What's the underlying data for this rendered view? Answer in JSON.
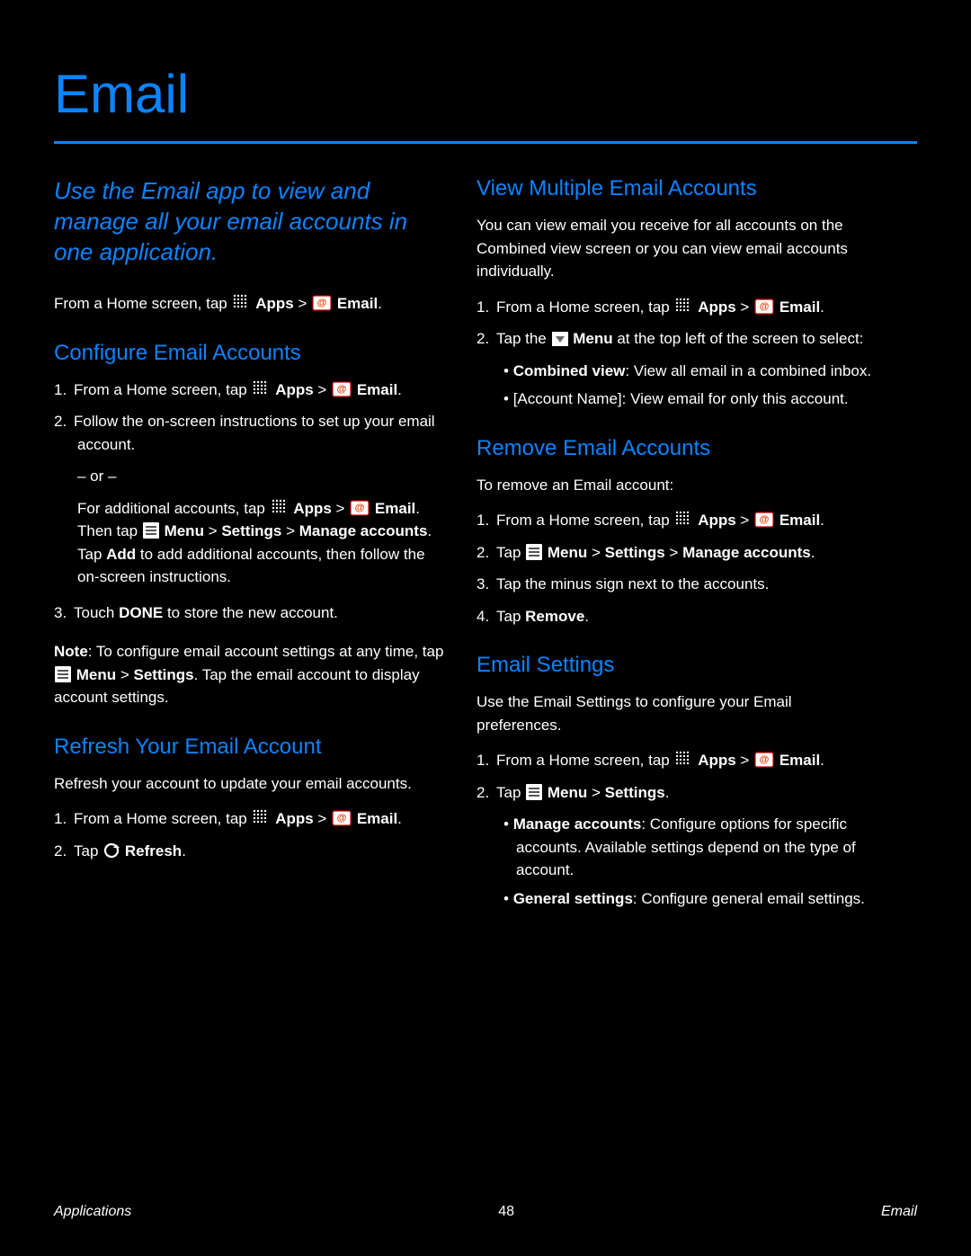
{
  "page_title": "Email",
  "intro": "Use the Email app to view and manage all your email accounts in one application.",
  "launch_prefix": "From a Home screen, tap ",
  "apps_label": "Apps",
  "email_label": "Email",
  "sections": {
    "configure": {
      "title": "Configure Email Accounts",
      "s1_a": "1.",
      "s1_b": "From a Home screen, tap ",
      "s1_c": "Apps",
      "s1_d": " > ",
      "s1_e": "Email",
      "s2_a": "2.",
      "s2_b": "Follow the on-screen instructions to set up your email account.",
      "or": "– or –",
      "alt_a": "For additional accounts, tap ",
      "alt_b": "Apps",
      "alt_c": " > ",
      "alt_d": "Email",
      "alt_e": ". Then tap ",
      "alt_f": "Menu",
      "alt_g": " > ",
      "alt_h": "Settings",
      "alt_i": " > ",
      "alt_j": "Manage accounts",
      "alt_k": ". Tap ",
      "alt_l": "Add",
      "alt_m": " to add additional accounts, then follow the on-screen instructions.",
      "s3_a": "3.",
      "s3_b": "Touch ",
      "s3_c": "DONE",
      "s3_d": " to store the new account.",
      "note_a": "Note",
      "note_b": ": To configure email account settings at any time, tap ",
      "note_c": "Menu",
      "note_d": " > ",
      "note_e": "Settings",
      "note_f": ". Tap the email account to display account settings."
    },
    "refresh": {
      "title": "Refresh Your Email Account",
      "lead": "Refresh your account to update your email accounts.",
      "s1_a": "1.",
      "s1_b": "From a Home screen, tap ",
      "s1_c": "Apps",
      "s1_d": " > ",
      "s1_e": "Email",
      "s2_a": "2.",
      "s2_b": "Tap ",
      "s2_c": "Refresh"
    },
    "view": {
      "title": "View Multiple Email Accounts",
      "lead": "You can view email you receive for all accounts on the Combined view screen or you can view email accounts individually.",
      "s1_a": "1.",
      "s1_b": "From a Home screen, tap ",
      "s1_c": "Apps",
      "s1_d": " > ",
      "s1_e": "Email",
      "s2_a": "2.",
      "s2_b": "Tap the ",
      "s2_c": "Menu",
      "s2_d": " at the top left of the screen to select:",
      "opt1_a": "Combined view",
      "opt1_b": ": View all email in a combined inbox.",
      "opt2": "[Account Name]: View email for only this account."
    },
    "remove": {
      "title": "Remove Email Accounts",
      "lead": "To remove an Email account:",
      "s1_a": "1.",
      "s1_b": "From a Home screen, tap ",
      "s1_c": "Apps",
      "s1_d": " > ",
      "s1_e": "Email",
      "s2_a": "2.",
      "s2_b": "Tap ",
      "s2_c": "Menu",
      "s2_d": " > ",
      "s2_e": "Settings",
      "s2_f": " > ",
      "s2_g": "Manage accounts",
      "s3_a": "3.",
      "s3_b": "Tap the minus sign ",
      "s3_c": "next to the accounts.",
      "s4_a": "4.",
      "s4_b": "Tap ",
      "s4_c": "Remove"
    },
    "settings": {
      "title": "Email Settings",
      "lead": "Use the Email Settings to configure your Email preferences.",
      "s1_a": "1.",
      "s1_b": "From a Home screen, tap ",
      "s1_c": "Apps",
      "s1_d": " > ",
      "s1_e": "Email",
      "s2_a": "2.",
      "s2_b": "Tap ",
      "s2_c": "Menu",
      "s2_d": " > ",
      "s2_e": "Settings",
      "opt1_a": "Manage accounts",
      "opt1_b": ": Configure options for specific accounts. Available settings depend on the type of account.",
      "opt2_a": "General settings",
      "opt2_b": ": Configure general email settings."
    }
  },
  "footer": {
    "left": "Applications",
    "center": "48",
    "right": "Email"
  }
}
